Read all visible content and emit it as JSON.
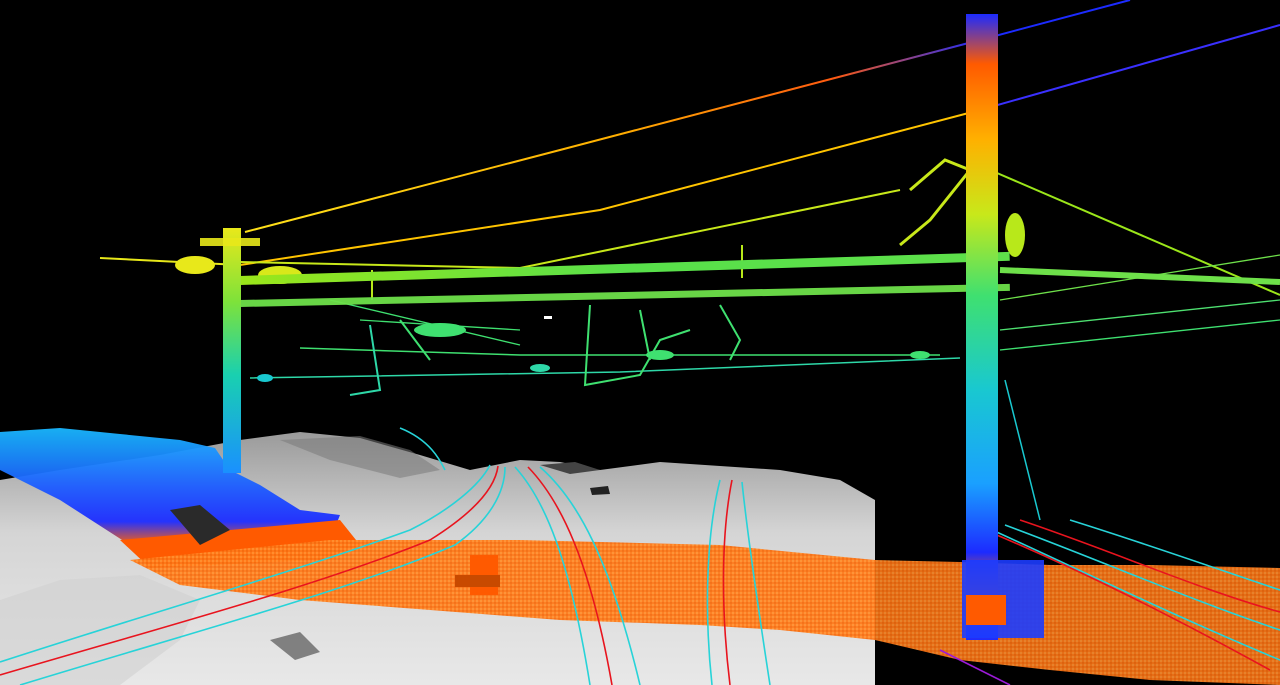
{
  "scene": {
    "subject": "lidar-point-cloud-railway-overhead-line",
    "background_color": "#000000",
    "terrain_color": "#d9d9d9",
    "rail_colors": [
      "#e8141e",
      "#27d3d8"
    ],
    "elevation_ramp": [
      "#ff6a00",
      "#1c2bff",
      "#19b8ff",
      "#2fe08a",
      "#9be61a",
      "#ffd400",
      "#ff7a00",
      "#1c2bff"
    ],
    "near_ground_color": "#ff7a1a"
  }
}
